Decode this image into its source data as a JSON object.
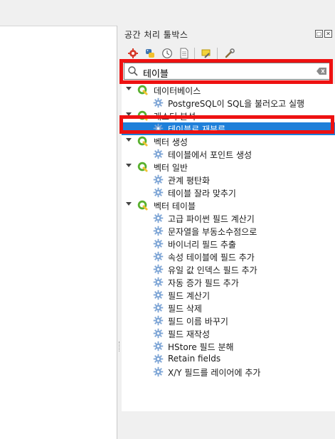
{
  "panel": {
    "title": "공간 처리 툴박스",
    "title_buttons": [
      "float-icon",
      "close-icon"
    ]
  },
  "toolbar": {
    "buttons": [
      "models-icon",
      "python-scripts-icon",
      "history-icon",
      "results-viewer-icon",
      "edit-features-in-place-icon",
      "options-icon"
    ]
  },
  "search": {
    "value": "테이블"
  },
  "tree": {
    "groups": [
      {
        "label": "데이터베이스",
        "algorithms": [
          {
            "label": "PostgreSQL이 SQL을 불러오고 실행"
          }
        ]
      },
      {
        "label": "래스터 분석",
        "algorithms": [
          {
            "label": "테이블로 재분류",
            "selected": true
          }
        ]
      },
      {
        "label": "벡터 생성",
        "algorithms": [
          {
            "label": "테이블에서 포인트 생성"
          }
        ]
      },
      {
        "label": "벡터 일반",
        "algorithms": [
          {
            "label": "관계 평탄화"
          },
          {
            "label": "테이블 잘라 맞추기"
          }
        ]
      },
      {
        "label": "벡터 테이블",
        "algorithms": [
          {
            "label": "고급 파이썬 필드 계산기"
          },
          {
            "label": "문자열을 부동소수점으로"
          },
          {
            "label": "바이너리 필드 추출"
          },
          {
            "label": "속성 테이블에 필드 추가"
          },
          {
            "label": "유일 값 인덱스 필드 추가"
          },
          {
            "label": "자동 증가 필드 추가"
          },
          {
            "label": "필드 계산기"
          },
          {
            "label": "필드 삭제"
          },
          {
            "label": "필드 이름 바꾸기"
          },
          {
            "label": "필드 재작성"
          },
          {
            "label": "HStore 필드 분해"
          },
          {
            "label": "Retain fields"
          },
          {
            "label": "X/Y 필드를 레이어에 추가"
          }
        ]
      }
    ]
  },
  "colors": {
    "selection": "#1e7fd9",
    "highlight_border": "#ee1111",
    "qgis_green": "#59b02f",
    "gear_blue": "#7fa6d6"
  }
}
